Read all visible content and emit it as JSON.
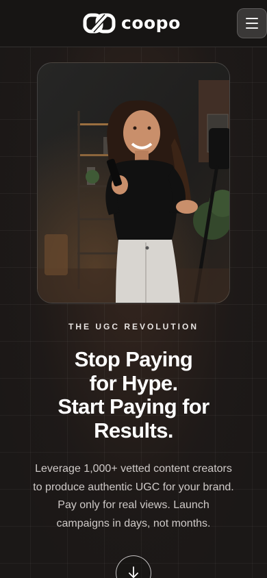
{
  "header": {
    "logo_text": "coopo",
    "logo_icon": "coopo-logo-mark",
    "menu_icon": "hamburger-icon"
  },
  "hero": {
    "image_alt": "Smiling creator holding a phone in a dark studio",
    "eyebrow": "THE UGC REVOLUTION",
    "headline_lines": [
      "Stop Paying",
      "for Hype.",
      "Start Paying for",
      "Results."
    ],
    "body_lines": [
      "Leverage 1,000+ vetted content creators",
      "to produce authentic UGC for your brand.",
      "Pay only for real views. Launch",
      "campaigns in days, not months."
    ],
    "scroll_icon": "arrow-down-icon"
  },
  "colors": {
    "background": "#1b1817",
    "header": "#171514",
    "text": "#ffffff",
    "muted_text": "#cfcac8"
  }
}
